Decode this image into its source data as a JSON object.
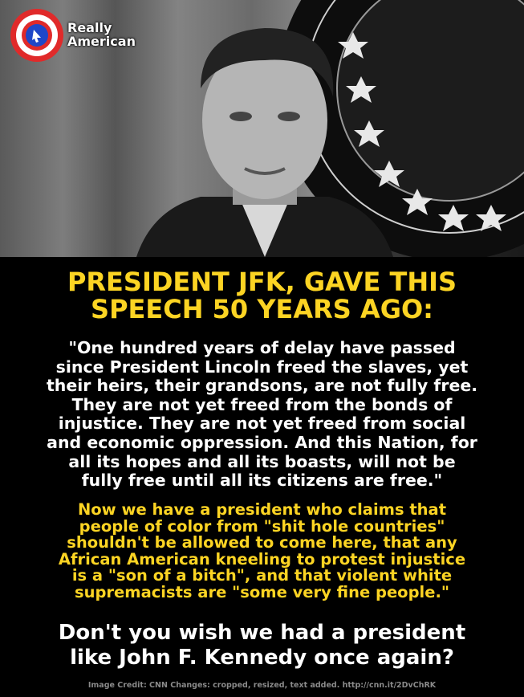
{
  "logo": {
    "line1": "Really",
    "line2": "American"
  },
  "headline": [
    "PRESIDENT JFK, GAVE THIS",
    "SPEECH 50 YEARS AGO:"
  ],
  "quote": [
    "\"One hundred years of delay have passed",
    "since President Lincoln freed the slaves, yet",
    "their heirs, their grandsons, are not fully free.",
    "They are not yet freed from the bonds of",
    "injustice. They are not yet freed from social",
    "and economic oppression. And this Nation, for",
    "all its hopes and all its boasts, will not be",
    "fully free until all its citizens are free.\""
  ],
  "current": [
    "Now we have a president who claims that",
    "people of color from \"shit hole countries\"",
    "shouldn't be allowed to come here, that any",
    "African American kneeling to protest injustice",
    "is a \"son of a bitch\", and that violent white",
    "supremacists are \"some very fine people.\""
  ],
  "closing": [
    "Don't you wish we had a president",
    "like John F. Kennedy once again?"
  ],
  "credit": "Image Credit: CNN Changes: cropped, resized, text added. http://cnn.it/2DvChRK",
  "colors": {
    "yellow": "#fcd423",
    "white": "#ffffff",
    "background": "#000000"
  }
}
